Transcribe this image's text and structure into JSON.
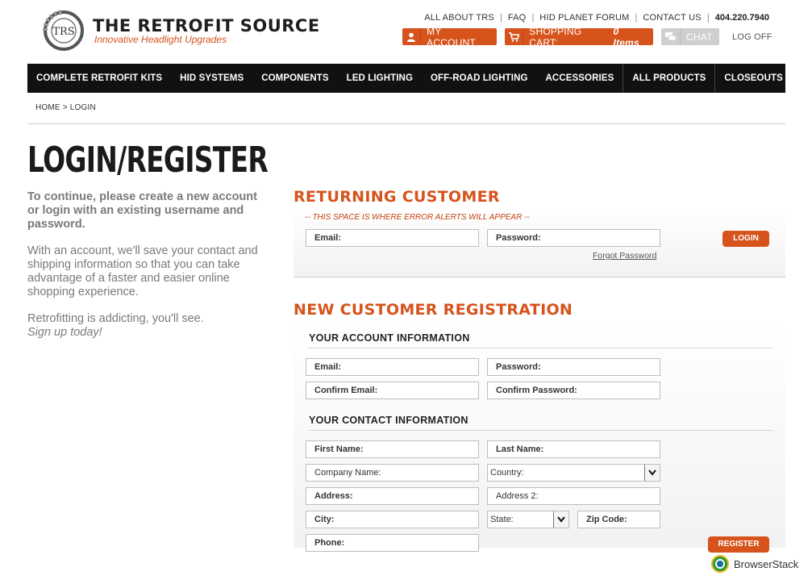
{
  "header": {
    "brand_name": "THE RETROFIT SOURCE",
    "brand_tagline": "Innovative Headlight Upgrades",
    "logo_text": "TRS",
    "top_links": [
      "ALL ABOUT TRS",
      "FAQ",
      "HID PLANET FORUM",
      "CONTACT US"
    ],
    "phone": "404.220.7940",
    "my_account": "MY ACCOUNT",
    "cart_label": "SHOPPING CART:",
    "cart_items": "0 Items",
    "chat": "CHAT",
    "log_off": "LOG OFF"
  },
  "nav": [
    "COMPLETE RETROFIT KITS",
    "HID SYSTEMS",
    "COMPONENTS",
    "LED LIGHTING",
    "OFF-ROAD LIGHTING",
    "ACCESSORIES",
    "ALL PRODUCTS",
    "CLOSEOUTS"
  ],
  "breadcrumb": "HOME > LOGIN",
  "page": {
    "title": "LOGIN/REGISTER",
    "intro_strong": "To continue, please create a new account or login with an existing username and password.",
    "intro_body": "With an account, we'll save your contact and shipping information so that you can take advantage of a faster and easier online shopping experience.",
    "intro_closing": "Retrofitting is addicting, you'll see.",
    "intro_cta": "Sign up today!"
  },
  "returning": {
    "heading": "RETURNING CUSTOMER",
    "error_alert": "-- THIS SPACE IS WHERE ERROR ALERTS WILL APPEAR --",
    "email": "Email:",
    "password": "Password:",
    "forgot": "Forgot Password",
    "login": "LOGIN"
  },
  "register": {
    "heading": "NEW CUSTOMER REGISTRATION",
    "account_heading": "YOUR ACCOUNT INFORMATION",
    "email": "Email:",
    "password": "Password:",
    "confirm_email": "Confirm Email:",
    "confirm_password": "Confirm Password:",
    "contact_heading": "YOUR CONTACT INFORMATION",
    "first_name": "First Name:",
    "last_name": "Last Name:",
    "company": "Company Name:",
    "country": "Country:",
    "address": "Address:",
    "address2": "Address 2:",
    "city": "City:",
    "state": "State:",
    "zip": "Zip Code:",
    "phone": "Phone:",
    "register": "REGISTER"
  },
  "footer_badge": "BrowserStack",
  "colors": {
    "accent": "#d6531c",
    "nav_bg": "#111111"
  },
  "icons": [
    "user-icon",
    "cart-icon",
    "chat-icon",
    "chevron-down-icon",
    "browserstack-logo"
  ]
}
